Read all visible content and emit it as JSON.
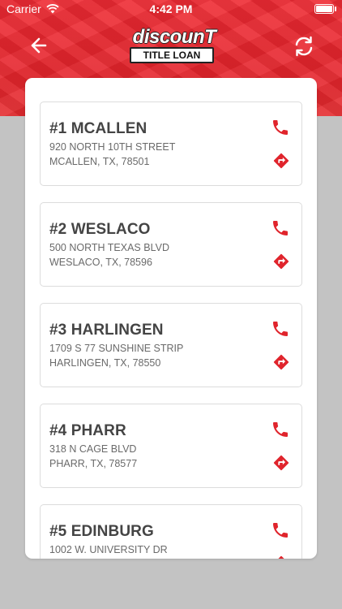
{
  "status_bar": {
    "carrier": "Carrier",
    "time": "4:42 PM"
  },
  "header": {
    "logo_top": "discounT",
    "logo_bottom": "TITLE LOAN",
    "back_icon": "arrow-left-icon",
    "refresh_icon": "refresh-icon"
  },
  "colors": {
    "brand_red": "#e6242c",
    "icon_red": "#e0242c",
    "background_gray": "#c3c3c3"
  },
  "locations": [
    {
      "name": "#1 MCALLEN",
      "address1": "920 NORTH 10TH STREET",
      "address2": "MCALLEN, TX, 78501"
    },
    {
      "name": "#2 WESLACO",
      "address1": "500 NORTH TEXAS BLVD",
      "address2": "WESLACO, TX, 78596"
    },
    {
      "name": "#3 HARLINGEN",
      "address1": "1709 S 77 SUNSHINE STRIP",
      "address2": "HARLINGEN, TX, 78550"
    },
    {
      "name": "#4 PHARR",
      "address1": "318 N CAGE BLVD",
      "address2": "PHARR, TX, 78577"
    },
    {
      "name": "#5 EDINBURG",
      "address1": "1002 W. UNIVERSITY DR",
      "address2": ""
    }
  ]
}
